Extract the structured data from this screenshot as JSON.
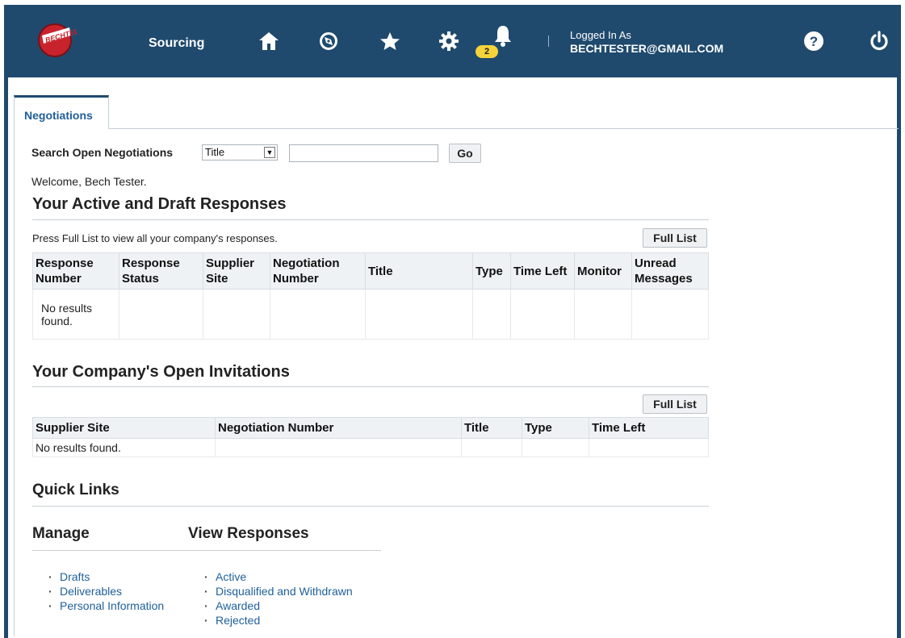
{
  "header": {
    "app_title": "Sourcing",
    "notification_count": "2",
    "logged_in_label": "Logged In As",
    "user_email": "BECHTESTER@GMAIL.COM",
    "icons": [
      "home-icon",
      "navigator-icon",
      "favorites-icon",
      "settings-icon",
      "notifications-icon",
      "help-icon",
      "logout-icon"
    ]
  },
  "tabs": [
    {
      "label": "Negotiations"
    }
  ],
  "search": {
    "label": "Search Open Negotiations",
    "selected": "Title",
    "value": "",
    "go_label": "Go"
  },
  "welcome": "Welcome, Bech Tester.",
  "responses": {
    "title": "Your Active and Draft Responses",
    "instruction": "Press Full List to view all your company's responses.",
    "full_list_label": "Full List",
    "columns": [
      "Response Number",
      "Response Status",
      "Supplier Site",
      "Negotiation Number",
      "Title",
      "Type",
      "Time Left",
      "Monitor",
      "Unread Messages"
    ],
    "empty_text": "No results found."
  },
  "invitations": {
    "title": "Your Company's Open Invitations",
    "full_list_label": "Full List",
    "columns": [
      "Supplier Site",
      "Negotiation Number",
      "Title",
      "Type",
      "Time Left"
    ],
    "empty_text": "No results found."
  },
  "quick_links": {
    "title": "Quick Links",
    "manage": {
      "title": "Manage",
      "items": [
        "Drafts",
        "Deliverables",
        "Personal Information"
      ]
    },
    "view_responses": {
      "title": "View Responses",
      "items": [
        "Active",
        "Disqualified and Withdrawn",
        "Awarded",
        "Rejected"
      ]
    }
  },
  "colors": {
    "header_bg": "#1f4a6e",
    "link": "#1f5f9a",
    "badge": "#f5d33a"
  }
}
